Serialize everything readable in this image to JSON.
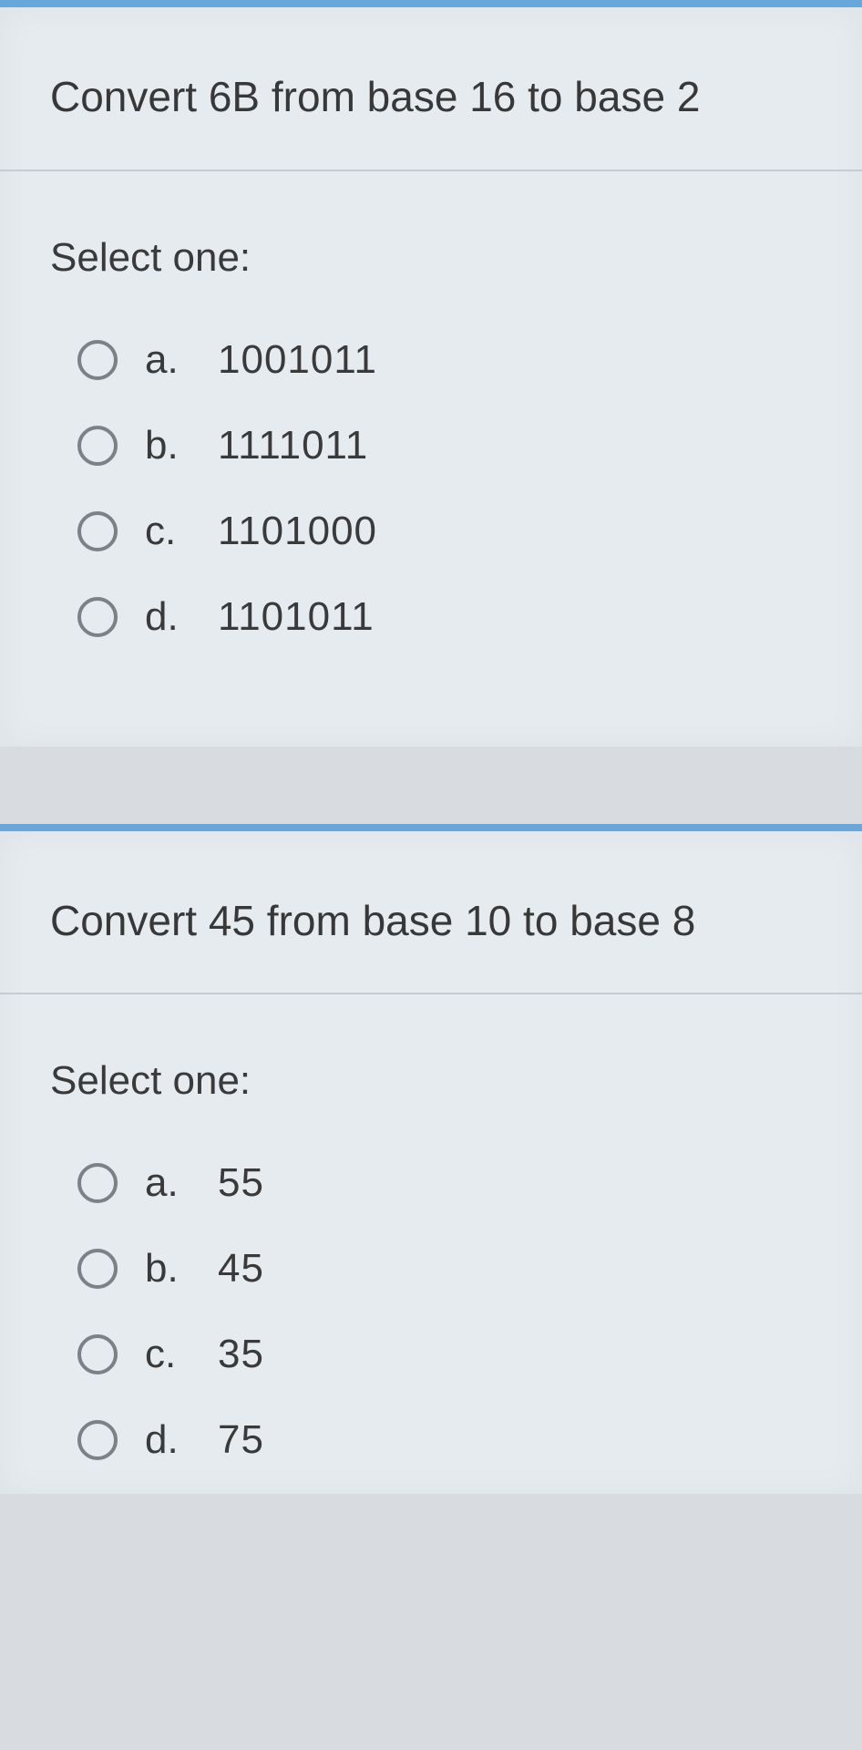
{
  "questions": [
    {
      "title": "Convert 6B from base 16 to base 2",
      "prompt": "Select one:",
      "options": [
        {
          "letter": "a.",
          "value": "1001011"
        },
        {
          "letter": "b.",
          "value": "1111011"
        },
        {
          "letter": "c.",
          "value": "1101000"
        },
        {
          "letter": "d.",
          "value": "1101011"
        }
      ]
    },
    {
      "title": "Convert 45 from base 10 to base 8",
      "prompt": "Select one:",
      "options": [
        {
          "letter": "a.",
          "value": "55"
        },
        {
          "letter": "b.",
          "value": "45"
        },
        {
          "letter": "c.",
          "value": "35"
        },
        {
          "letter": "d.",
          "value": "75"
        }
      ]
    }
  ]
}
